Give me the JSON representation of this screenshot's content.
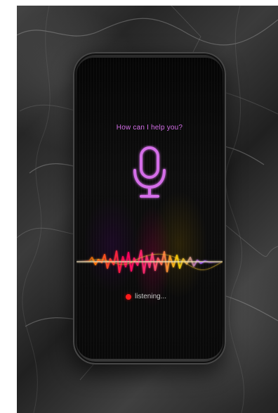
{
  "assistant": {
    "prompt": "How can I help you?",
    "status": "listening..."
  },
  "icons": {
    "microphone": "microphone-icon",
    "status_dot": "record-dot-icon"
  },
  "colors": {
    "accent": "#d46ee8",
    "status_dot": "#ff1b1b",
    "status_text": "#c9c9c9"
  }
}
